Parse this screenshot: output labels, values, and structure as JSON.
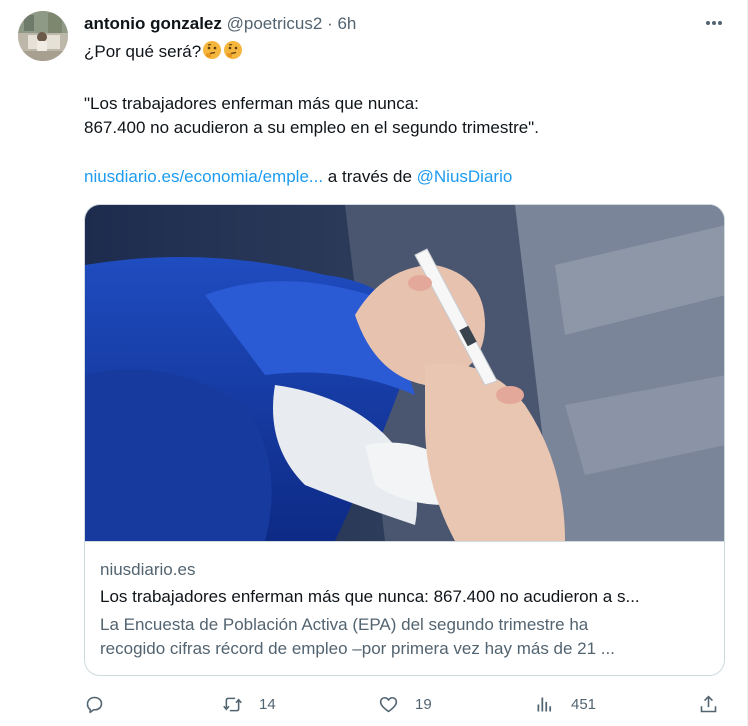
{
  "tweet": {
    "author": {
      "name": "antonio gonzalez",
      "handle": "@poetricus2",
      "separator": "·",
      "time": "6h"
    },
    "text": {
      "line1": "¿Por qué será?",
      "emojis": [
        "thinking-face-emoji",
        "thinking-face-emoji"
      ],
      "quote_line1": "\"Los trabajadores enferman más que nunca:",
      "quote_line2": "867.400 no acudieron a su empleo en el segundo trimestre\".",
      "link_url": "niusdiario.es/economia/emple...",
      "via_text": " a través de ",
      "mention": "@NiusDiario"
    },
    "card": {
      "domain": "niusdiario.es",
      "title": "Los trabajadores enferman más que nunca: 867.400 no acudieron a s...",
      "description_line1": "La Encuesta de Población Activa (EPA) del segundo trimestre ha",
      "description_line2": "recogido cifras récord de empleo –por primera vez hay más de 21 ..."
    },
    "actions": {
      "reply_count": "",
      "retweet_count": "14",
      "like_count": "19",
      "views_count": "451"
    }
  },
  "colors": {
    "link": "#1d9bf0",
    "secondary_text": "#536471",
    "primary_text": "#0f1419",
    "border": "#cfd9de"
  }
}
